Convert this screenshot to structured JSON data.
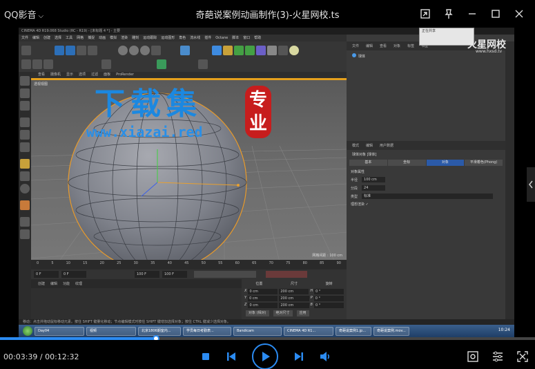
{
  "player": {
    "brand": "QQ影音",
    "file_title": "奇葩说案例动画制作(3)-火星网校.ts",
    "current_time": "00:03:39",
    "total_time": "00:12:32",
    "progress": 0.291,
    "accent": "#2b8bf2"
  },
  "app": {
    "title": "CINEMA 4D R19.068 Studio (RC - R19) - [未标题 4 *] - 主要",
    "menus": [
      "文件",
      "编辑",
      "创建",
      "选择",
      "工具",
      "网格",
      "捕捉",
      "动画",
      "模拟",
      "渲染",
      "雕刻",
      "运动跟踪",
      "运动图形",
      "角色",
      "流水线",
      "插件",
      "Octane",
      "脚本",
      "窗口",
      "帮助"
    ],
    "toolbar_icons": [
      "undo-icon",
      "select-icon",
      "move-icon",
      "scale-icon",
      "rotate-icon",
      "axis-x-icon",
      "axis-y-icon",
      "axis-z-icon",
      "coord-icon",
      "render-icon",
      "cube-icon",
      "pen-icon",
      "subdivision-icon",
      "cloner-icon",
      "deformer-icon",
      "floor-icon",
      "camera-icon",
      "light-icon"
    ]
  },
  "viewport": {
    "menu": [
      "查看",
      "摄像机",
      "显示",
      "选项",
      "过滤",
      "面板",
      "ProRender"
    ],
    "label": "透视视图",
    "grid_scale": "网格间距 : 100 cm",
    "watermark_title": "下载集",
    "watermark_url": "www.xiazai.red",
    "watermark_seal_1": "专",
    "watermark_seal_2": "业"
  },
  "timeline": {
    "ticks": [
      "0",
      "5",
      "10",
      "15",
      "20",
      "25",
      "30",
      "35",
      "40",
      "45",
      "50",
      "55",
      "60",
      "65",
      "70",
      "75",
      "80",
      "85",
      "90"
    ],
    "frame_start": "0 F",
    "frame_mid": "0 F",
    "frame_end": "100 F",
    "frame_end2": "100 F"
  },
  "material": {
    "menu": [
      "创建",
      "编辑",
      "功能",
      "纹理"
    ]
  },
  "coords": {
    "headers": [
      "位置",
      "尺寸",
      "旋转"
    ],
    "rows": [
      {
        "axis": "X",
        "pos": "0 cm",
        "size": "200 cm",
        "rot_axis": "H",
        "rot": "0 °"
      },
      {
        "axis": "Y",
        "pos": "0 cm",
        "size": "200 cm",
        "rot_axis": "P",
        "rot": "0 °"
      },
      {
        "axis": "Z",
        "pos": "0 cm",
        "size": "200 cm",
        "rot_axis": "B",
        "rot": "0 °"
      }
    ],
    "mode": "对象 (相对)",
    "size_mode": "绝对尺寸",
    "apply": "应用"
  },
  "objects": {
    "menu": [
      "文件",
      "编辑",
      "查看",
      "对象",
      "标签",
      "书签"
    ],
    "item": "球体"
  },
  "attributes": {
    "menu": [
      "模式",
      "编辑",
      "用户数据"
    ],
    "title": "球体对象 [球体]",
    "tabs": [
      "基本",
      "坐标",
      "对象",
      "平滑着色(Phong)"
    ],
    "section": "对象属性",
    "fields": [
      {
        "label": "半径",
        "value": "100 cm"
      },
      {
        "label": "分段",
        "value": "24"
      },
      {
        "label": "类型",
        "value": "标准"
      }
    ],
    "render_perfect": "理想渲染 ✓"
  },
  "status_bar": "移动：点击并拖动鼠标移动元素。按住 SHIFT 键量化移动；节点编辑模式时按住 SHIFT 键增加选择对象；按住 CTRL 键减少选择对象。",
  "ime_title": "正在共享",
  "hx_watermark": "火星网校",
  "hx_url": "www.hxsd.tv",
  "taskbar": {
    "items": [
      "Day04",
      "视频",
      "北京1806期室内...",
      "学员每日考勤表...",
      "Bandicam",
      "CINEMA 4D R1...",
      "奇葩说案例1.jp...",
      "奇葩说案例.mov..."
    ],
    "clock": "10:24"
  }
}
